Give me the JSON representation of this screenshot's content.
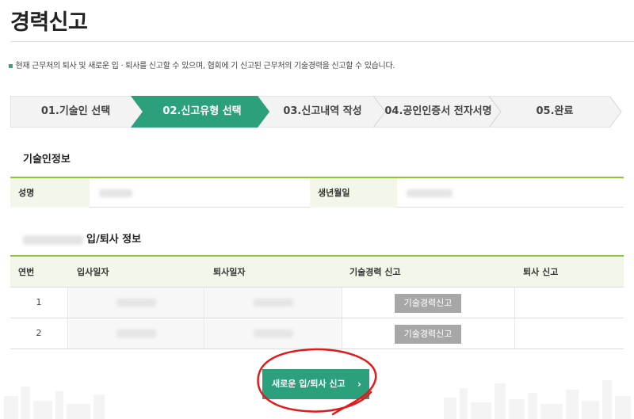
{
  "page": {
    "title": "경력신고",
    "notice": "현재 근무처의 퇴사 및 새로운 입 · 퇴사를 신고할 수 있으며, 협회에 기 신고된 근무처의 기술경력을 신고할 수 있습니다."
  },
  "steps": [
    {
      "label": "01.기술인 선택",
      "active": false
    },
    {
      "label": "02.신고유형 선택",
      "active": true
    },
    {
      "label": "03.신고내역 작성",
      "active": false
    },
    {
      "label": "04.공인인증서 전자서명",
      "active": false
    },
    {
      "label": "05.완료",
      "active": false
    }
  ],
  "colors": {
    "accent": "#2c9f7d",
    "table_border": "#8cc63f",
    "header_bg": "#f2f7e9"
  },
  "tech_info": {
    "title": "기술인정보",
    "name_label": "성명",
    "birth_label": "생년월일"
  },
  "work_info": {
    "title_suffix": "입/퇴사 정보",
    "headers": [
      "연번",
      "입사일자",
      "퇴사일자",
      "기술경력 신고",
      "퇴사 신고"
    ],
    "rows": [
      {
        "no": "1",
        "career_button": "기술경력신고"
      },
      {
        "no": "2",
        "career_button": "기술경력신고"
      }
    ]
  },
  "actions": {
    "new_report": "새로운 입/퇴사 신고",
    "chevron_icon": "chevron-right-icon"
  }
}
